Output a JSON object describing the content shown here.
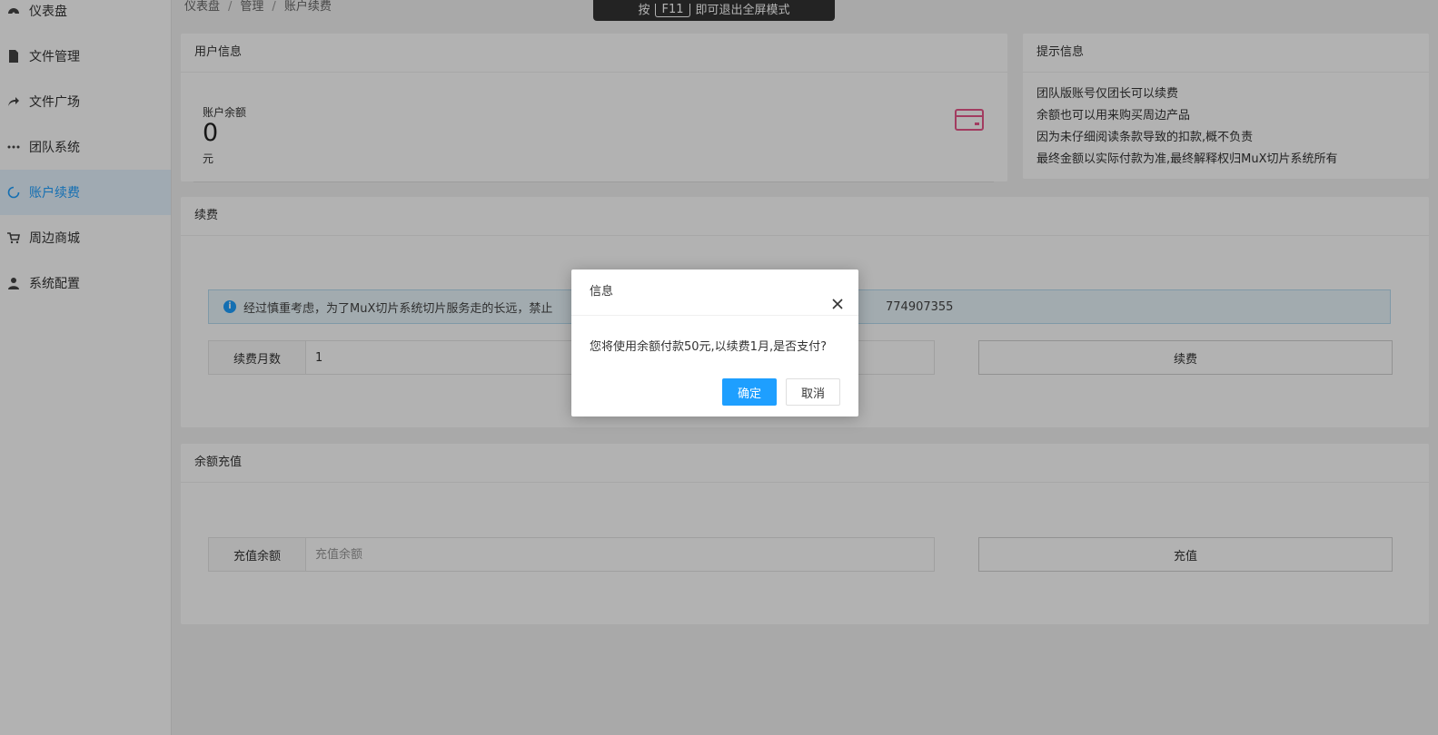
{
  "sidebar": {
    "items": [
      {
        "label": "仪表盘",
        "icon": "dashboard-icon"
      },
      {
        "label": "文件管理",
        "icon": "file-icon"
      },
      {
        "label": "文件广场",
        "icon": "share-icon"
      },
      {
        "label": "团队系统",
        "icon": "ellipsis-icon"
      },
      {
        "label": "账户续费",
        "icon": "loading-circle-icon",
        "active": true
      },
      {
        "label": "周边商城",
        "icon": "cart-icon"
      },
      {
        "label": "系统配置",
        "icon": "user-icon"
      }
    ]
  },
  "breadcrumb": [
    "仪表盘",
    "管理",
    "账户续费"
  ],
  "fullscreen_hint": {
    "pre": "按",
    "key": "F11",
    "post": "即可退出全屏模式"
  },
  "user_info": {
    "title": "用户信息",
    "balance_label": "账户余额",
    "balance_value": "0",
    "balance_unit": "元"
  },
  "tips": {
    "title": "提示信息",
    "lines": [
      "团队版账号仅团长可以续费",
      "余额也可以用来购买周边产品",
      "因为未仔细阅读条款导致的扣款,概不负责",
      "最终金额以实际付款为准,最终解释权归MuX切片系统所有"
    ]
  },
  "renew": {
    "title": "续费",
    "alert_text": "经过慎重考虑，为了MuX切片系统切片服务走的长远，禁止",
    "alert_tail": "774907355",
    "months_label": "续费月数",
    "months_value": "1",
    "button": "续费"
  },
  "recharge": {
    "title": "余额充值",
    "amount_label": "充值余额",
    "amount_placeholder": "充值余额",
    "button": "充值"
  },
  "modal": {
    "title": "信息",
    "message": "您将使用余额付款50元,以续费1月,是否支付?",
    "ok": "确定",
    "cancel": "取消"
  },
  "colors": {
    "accent": "#1e9fff",
    "card_icon": "#e8578a",
    "alert_bg": "#e8f5fb"
  }
}
